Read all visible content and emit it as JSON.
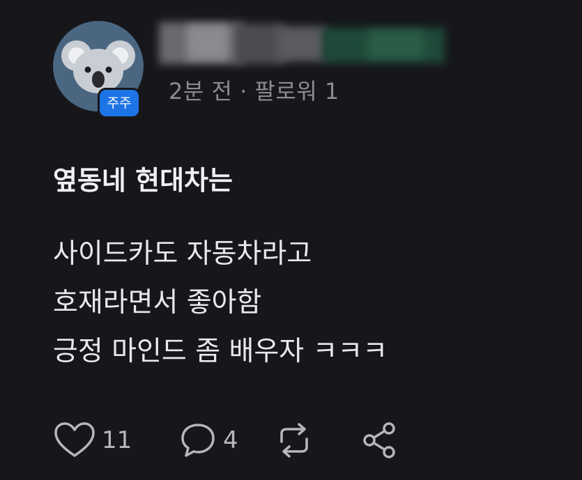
{
  "author": {
    "badge_label": "주주",
    "meta_text": "2분 전 · 팔로워 1"
  },
  "post": {
    "title": "옆동네 현대차는",
    "body_lines": [
      "사이드카도 자동차라고",
      "호재라면서 좋아함",
      "긍정 마인드 좀 배우자 ㅋㅋㅋ"
    ]
  },
  "actions": {
    "like_count": "11",
    "comment_count": "4"
  },
  "icons": {
    "like": "heart-icon",
    "comment": "comment-bubble-icon",
    "repost": "repost-icon",
    "share": "share-icon"
  },
  "colors": {
    "background": "#17171b",
    "badge": "#1d74e6",
    "avatar": "#4b6680",
    "meta_text": "#8b8b94"
  }
}
